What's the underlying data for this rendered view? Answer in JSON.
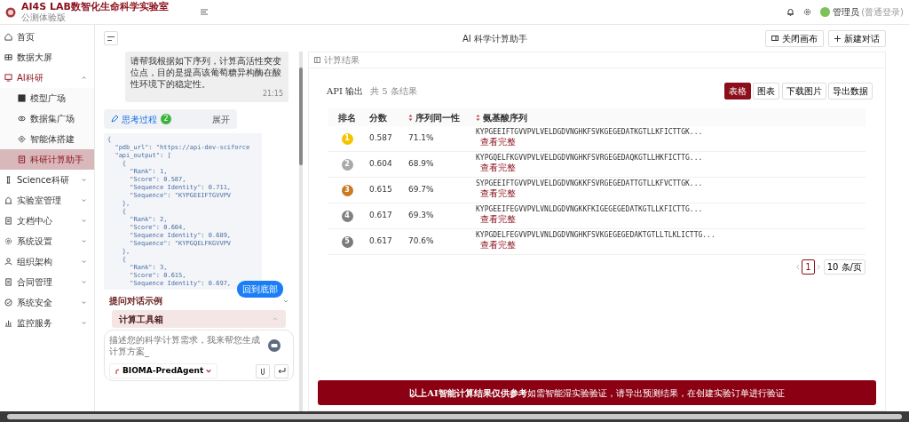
{
  "header": {
    "title": "AI4S LAB数智化生命科学实验室",
    "subtitle": "公测体验版",
    "user": "管理员",
    "login_type": "(普通登录)"
  },
  "sidebar": {
    "items": [
      {
        "label": "首页",
        "selected": false
      },
      {
        "label": "数据大屏",
        "selected": false
      },
      {
        "label": "AI科研",
        "selected": false,
        "expanded": true,
        "children": [
          {
            "label": "模型广场",
            "selected": false
          },
          {
            "label": "数据集广场",
            "selected": false
          },
          {
            "label": "智能体搭建",
            "selected": false
          },
          {
            "label": "科研计算助手",
            "selected": true
          }
        ]
      },
      {
        "label": "Science科研",
        "selected": false,
        "expanded": false
      },
      {
        "label": "实验室管理",
        "selected": false,
        "expanded": false
      },
      {
        "label": "文档中心",
        "selected": false,
        "expanded": false
      },
      {
        "label": "系统设置",
        "selected": false,
        "expanded": false
      },
      {
        "label": "组织架构",
        "selected": false,
        "expanded": false
      },
      {
        "label": "合同管理",
        "selected": false,
        "expanded": false
      },
      {
        "label": "系统安全",
        "selected": false,
        "expanded": false
      },
      {
        "label": "监控服务",
        "selected": false,
        "expanded": false
      }
    ]
  },
  "chat": {
    "title": "AI 科学计算助手",
    "buttons": [
      "关闭画布",
      "新建对话"
    ],
    "message": {
      "text": "请帮我根据如下序列，计算高活性突变位点，目的是提高该葡萄糖异构酶在酸性环境下的稳定性。",
      "time": "21:15"
    },
    "thinking": {
      "label": "思考过程",
      "count": "2",
      "toggle": "展开"
    },
    "code_lines": [
      "{",
      "  \"pdb_url\": \"https://api-dev-sciforce",
      "  \"api_output\": [",
      "    {",
      "      \"Rank\": 1,",
      "      \"Score\": 0.587,",
      "      \"Sequence Identity\": 0.711,",
      "      \"Sequence\": \"KYPGEEIFTGVVPV",
      "    },",
      "    {",
      "      \"Rank\": 2,",
      "      \"Score\": 0.604,",
      "      \"Sequence Identity\": 0.689,",
      "      \"Sequence\": \"KYPGQELFKGVVPV",
      "    },",
      "    {",
      "      \"Rank\": 3,",
      "      \"Score\": 0.615,",
      "      \"Sequence Identity\": 0.697,"
    ],
    "back_to_bottom": "回到底部",
    "examples_label": "提问对话示例",
    "toolbox_label": "计算工具箱",
    "input": {
      "placeholder": "描述您的科学计算需求，我来帮您生成计算方案_",
      "agent": "BIOMA-PredAgent"
    }
  },
  "results": {
    "panel_title": "计算结果",
    "title": "API 输出",
    "summary": "共 5 条结果",
    "views": [
      {
        "label": "表格",
        "selected": true
      },
      {
        "label": "图表",
        "selected": false
      }
    ],
    "actions": [
      "下载图片",
      "导出数据"
    ],
    "columns": [
      "排名",
      "分数",
      "序列同一性",
      "氨基酸序列"
    ],
    "rows": [
      {
        "rank": "1",
        "color": "#f5c400",
        "score": "0.587",
        "identity": "71.1%",
        "sequence": "KYPGEEIFTGVVPVLVELDGDVNGHKFSVKGEGEDATKGTLLKFICTTGK...",
        "link": "查看完整"
      },
      {
        "rank": "2",
        "color": "#a9a9a9",
        "score": "0.604",
        "identity": "68.9%",
        "sequence": "KYPGQELFKGVVPVLVELDGDVNGHKFSVRGEGEDAQKGTLLHKFICTTG...",
        "link": "查看完整"
      },
      {
        "rank": "3",
        "color": "#c97a22",
        "score": "0.615",
        "identity": "69.7%",
        "sequence": "SYPGEEIFTGVVPVLVELDGDVNGKKFSVRGEGEDATTGTLLKFVCTTGK...",
        "link": "查看完整"
      },
      {
        "rank": "4",
        "color": "#808080",
        "score": "0.617",
        "identity": "69.3%",
        "sequence": "KYPGEEIFEGVVPVLVNLDGDVNGKKFKIGEGEGEDATKGTLLKFICTTG...",
        "link": "查看完整"
      },
      {
        "rank": "5",
        "color": "#7a7a7a",
        "score": "0.617",
        "identity": "70.6%",
        "sequence": "KYPGDELFEGVVPVLVNLDGDVNGHKFSVKGEGEGEDAKTGTLLTLKLICTTG...",
        "link": "查看完整"
      }
    ],
    "pagination": {
      "pages": [
        {
          "label": "1",
          "selected": true
        }
      ],
      "page_size": "10 条/页"
    },
    "banner": "**以上AI智能计算结果仅供参考**如需智能湿实验验证，请导出预测结果，在创建实验订单进行验证"
  }
}
